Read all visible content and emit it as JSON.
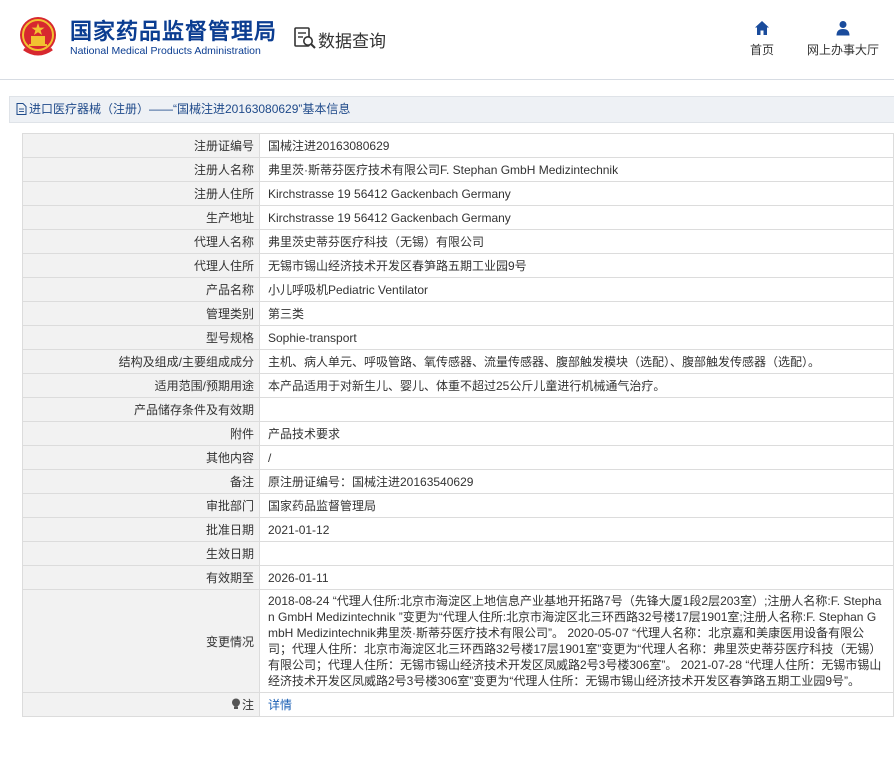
{
  "header": {
    "org_name_cn": "国家药品监督管理局",
    "org_name_en": "National Medical Products Administration",
    "query_title": "数据查询",
    "emblem_icon": "national-emblem-icon",
    "query_icon": "document-search-icon",
    "nav": [
      {
        "label": "首页",
        "icon": "home-icon"
      },
      {
        "label": "网上办事大厅",
        "icon": "user-icon"
      }
    ]
  },
  "breadcrumb": {
    "text": "进口医疗器械（注册）——“国械注进20163080629”基本信息",
    "icon": "document-icon"
  },
  "rows": [
    {
      "label": "注册证编号",
      "value": "国械注进20163080629"
    },
    {
      "label": "注册人名称",
      "value": "弗里茨·斯蒂芬医疗技术有限公司F. Stephan GmbH Medizintechnik"
    },
    {
      "label": "注册人住所",
      "value": "Kirchstrasse 19 56412 Gackenbach Germany"
    },
    {
      "label": "生产地址",
      "value": "Kirchstrasse 19 56412 Gackenbach Germany"
    },
    {
      "label": "代理人名称",
      "value": "弗里茨史蒂芬医疗科技（无锡）有限公司"
    },
    {
      "label": "代理人住所",
      "value": "无锡市锡山经济技术开发区春笋路五期工业园9号"
    },
    {
      "label": "产品名称",
      "value": "小儿呼吸机Pediatric Ventilator"
    },
    {
      "label": "管理类别",
      "value": "第三类"
    },
    {
      "label": "型号规格",
      "value": "Sophie-transport"
    },
    {
      "label": "结构及组成/主要组成成分",
      "value": "主机、病人单元、呼吸管路、氧传感器、流量传感器、腹部触发模块（选配）、腹部触发传感器（选配）。"
    },
    {
      "label": "适用范围/预期用途",
      "value": "本产品适用于对新生儿、婴儿、体重不超过25公斤儿童进行机械通气治疗。"
    },
    {
      "label": "产品储存条件及有效期",
      "value": ""
    },
    {
      "label": "附件",
      "value": "产品技术要求"
    },
    {
      "label": "其他内容",
      "value": "/"
    },
    {
      "label": "备注",
      "value": "原注册证编号：国械注进20163540629"
    },
    {
      "label": "审批部门",
      "value": "国家药品监督管理局"
    },
    {
      "label": "批准日期",
      "value": "2021-01-12"
    },
    {
      "label": "生效日期",
      "value": ""
    },
    {
      "label": "有效期至",
      "value": "2026-01-11"
    }
  ],
  "changes": {
    "label": "变更情况",
    "value": "2018-08-24 “代理人住所:北京市海淀区上地信息产业基地开拓路7号（先锋大厦1段2层203室）;注册人名称:F. Stephan GmbH Medizintechnik ”变更为“代理人住所:北京市海淀区北三环西路32号楼17层1901室;注册人名称:F. Stephan GmbH Medizintechnik弗里茨·斯蒂芬医疗技术有限公司”。 2020-05-07 “代理人名称：北京嘉和美康医用设备有限公司；代理人住所：北京市海淀区北三环西路32号楼17层1901室”变更为“代理人名称：弗里茨史蒂芬医疗科技（无锡）有限公司；代理人住所：无锡市锡山经济技术开发区凤威路2号3号楼306室”。 2021-07-28 “代理人住所：无锡市锡山经济技术开发区凤威路2号3号楼306室”变更为“代理人住所：无锡市锡山经济技术开发区春笋路五期工业园9号”。"
  },
  "note_row": {
    "label": "注",
    "icon": "lightbulb-icon",
    "link": "详情"
  }
}
